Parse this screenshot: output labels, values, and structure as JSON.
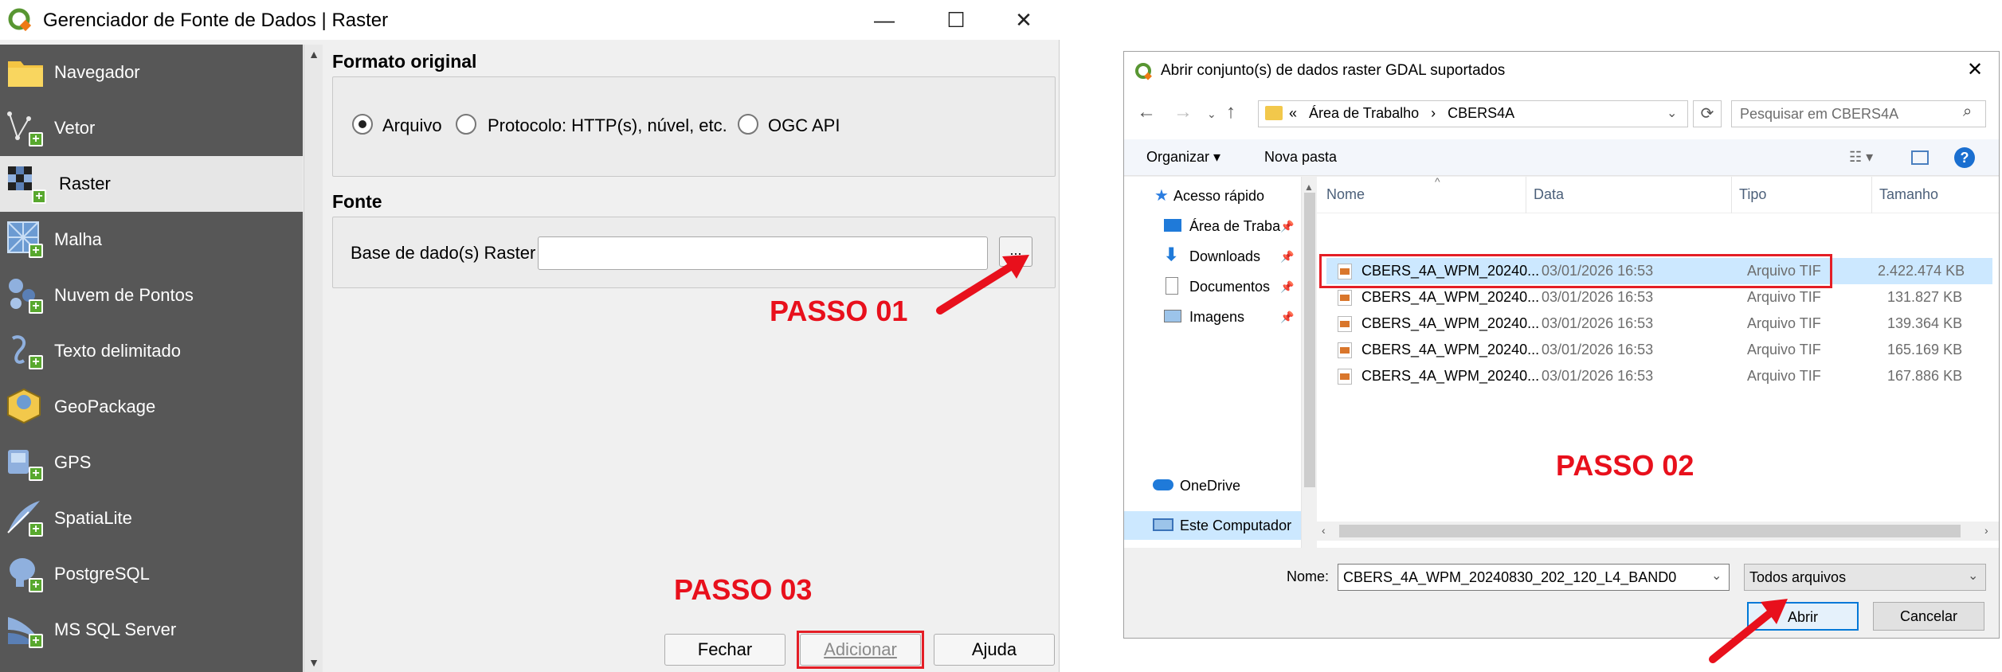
{
  "qgis": {
    "title": "Gerenciador de Fonte de Dados | Raster",
    "window_controls": {
      "minimize": "—",
      "maximize": "☐",
      "close": "✕"
    },
    "sidebar": [
      {
        "label": "Navegador",
        "icon": "folder-icon"
      },
      {
        "label": "Vetor",
        "icon": "vector-icon"
      },
      {
        "label": "Raster",
        "icon": "raster-icon",
        "active": true
      },
      {
        "label": "Malha",
        "icon": "mesh-icon"
      },
      {
        "label": "Nuvem de Pontos",
        "icon": "point-cloud-icon"
      },
      {
        "label": "Texto delimitado",
        "icon": "delimited-text-icon"
      },
      {
        "label": "GeoPackage",
        "icon": "geopackage-icon"
      },
      {
        "label": "GPS",
        "icon": "gps-icon"
      },
      {
        "label": "SpatiaLite",
        "icon": "spatialite-icon"
      },
      {
        "label": "PostgreSQL",
        "icon": "postgresql-icon"
      },
      {
        "label": "MS SQL Server",
        "icon": "mssql-icon"
      }
    ],
    "formato": {
      "title": "Formato original",
      "options": [
        "Arquivo",
        "Protocolo: HTTP(s), núvel, etc.",
        "OGC API"
      ],
      "selected": "Arquivo"
    },
    "fonte": {
      "title": "Fonte",
      "label": "Base de dado(s) Raster",
      "value": "",
      "browse": "..."
    },
    "buttons": {
      "fechar": "Fechar",
      "adicionar": "Adicionar",
      "ajuda": "Ajuda"
    },
    "passo1": "PASSO 01",
    "passo3": "PASSO 03"
  },
  "dialog": {
    "title": "Abrir conjunto(s) de dados raster GDAL suportados",
    "close": "✕",
    "address": {
      "prefix": "«",
      "path": [
        "Área de Trabalho",
        "CBERS4A"
      ],
      "sep": "›"
    },
    "search_placeholder": "Pesquisar em CBERS4A",
    "toolbar": {
      "organize": "Organizar ▾",
      "new_folder": "Nova pasta"
    },
    "nav": [
      {
        "label": "Acesso rápido",
        "icon": "star-icon"
      },
      {
        "label": "Área de Traba",
        "icon": "desktop-icon"
      },
      {
        "label": "Downloads",
        "icon": "download-icon"
      },
      {
        "label": "Documentos",
        "icon": "document-icon"
      },
      {
        "label": "Imagens",
        "icon": "images-icon"
      },
      {
        "label": "OneDrive",
        "icon": "cloud-icon"
      },
      {
        "label": "Este Computador",
        "icon": "computer-icon"
      }
    ],
    "columns": {
      "name": "Nome",
      "date": "Data",
      "type": "Tipo",
      "size": "Tamanho"
    },
    "files": [
      {
        "name": "CBERS_4A_WPM_20240...",
        "date": "03/01/2026 16:53",
        "type": "Arquivo TIF",
        "size": "2.422.474 KB",
        "selected": true
      },
      {
        "name": "CBERS_4A_WPM_20240...",
        "date": "03/01/2026 16:53",
        "type": "Arquivo TIF",
        "size": "131.827 KB"
      },
      {
        "name": "CBERS_4A_WPM_20240...",
        "date": "03/01/2026 16:53",
        "type": "Arquivo TIF",
        "size": "139.364 KB"
      },
      {
        "name": "CBERS_4A_WPM_20240...",
        "date": "03/01/2026 16:53",
        "type": "Arquivo TIF",
        "size": "165.169 KB"
      },
      {
        "name": "CBERS_4A_WPM_20240...",
        "date": "03/01/2026 16:53",
        "type": "Arquivo TIF",
        "size": "167.886 KB"
      }
    ],
    "nome_label": "Nome:",
    "nome_value": "CBERS_4A_WPM_20240830_202_120_L4_BAND0",
    "filter": "Todos arquivos",
    "open": "Abrir",
    "cancel": "Cancelar",
    "passo2": "PASSO 02"
  }
}
